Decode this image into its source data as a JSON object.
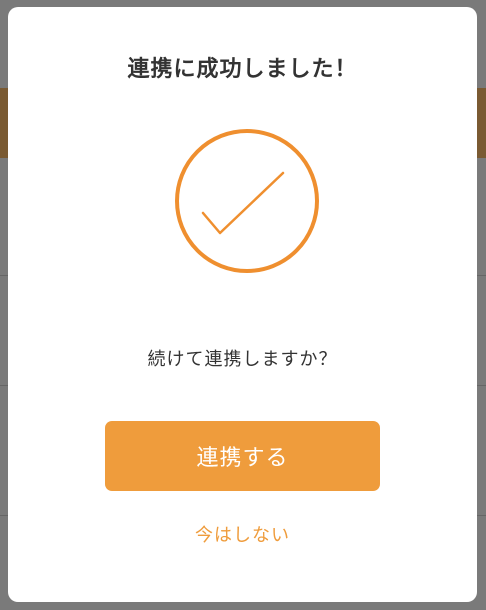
{
  "dialog": {
    "title": "連携に成功しました！",
    "message": "続けて連携しますか？",
    "primary_button_label": "連携する",
    "secondary_link_label": "今はしない",
    "status_icon": "check-circle-icon"
  },
  "colors": {
    "accent": "#ef9c3c",
    "text": "#333333",
    "overlay": "#6f6f6f"
  }
}
